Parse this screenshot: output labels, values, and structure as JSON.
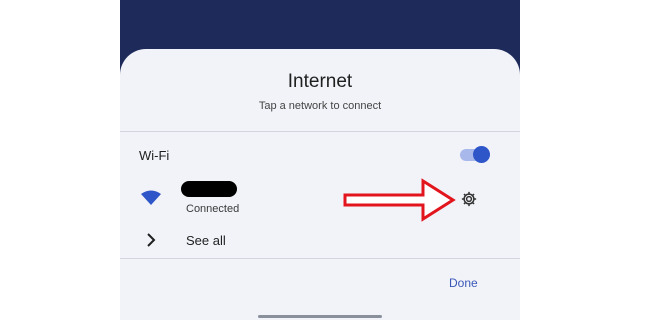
{
  "panel": {
    "title": "Internet",
    "subtitle": "Tap a network to connect"
  },
  "wifi": {
    "label": "Wi-Fi",
    "toggle_on": true
  },
  "network": {
    "status": "Connected",
    "icon": "wifi-signal-icon",
    "settings_icon": "gear-icon",
    "name_redacted": true
  },
  "see_all": {
    "label": "See all",
    "icon": "chevron-right-icon"
  },
  "actions": {
    "done_label": "Done"
  },
  "annotation": {
    "type": "red-outline-arrow",
    "points_to": "gear-icon"
  },
  "colors": {
    "backdrop": "#1e2a5a",
    "sheet": "#f1f3f8",
    "accent": "#2f56c9",
    "accent_light": "#a9b8ea",
    "arrow": "#e2141c"
  }
}
